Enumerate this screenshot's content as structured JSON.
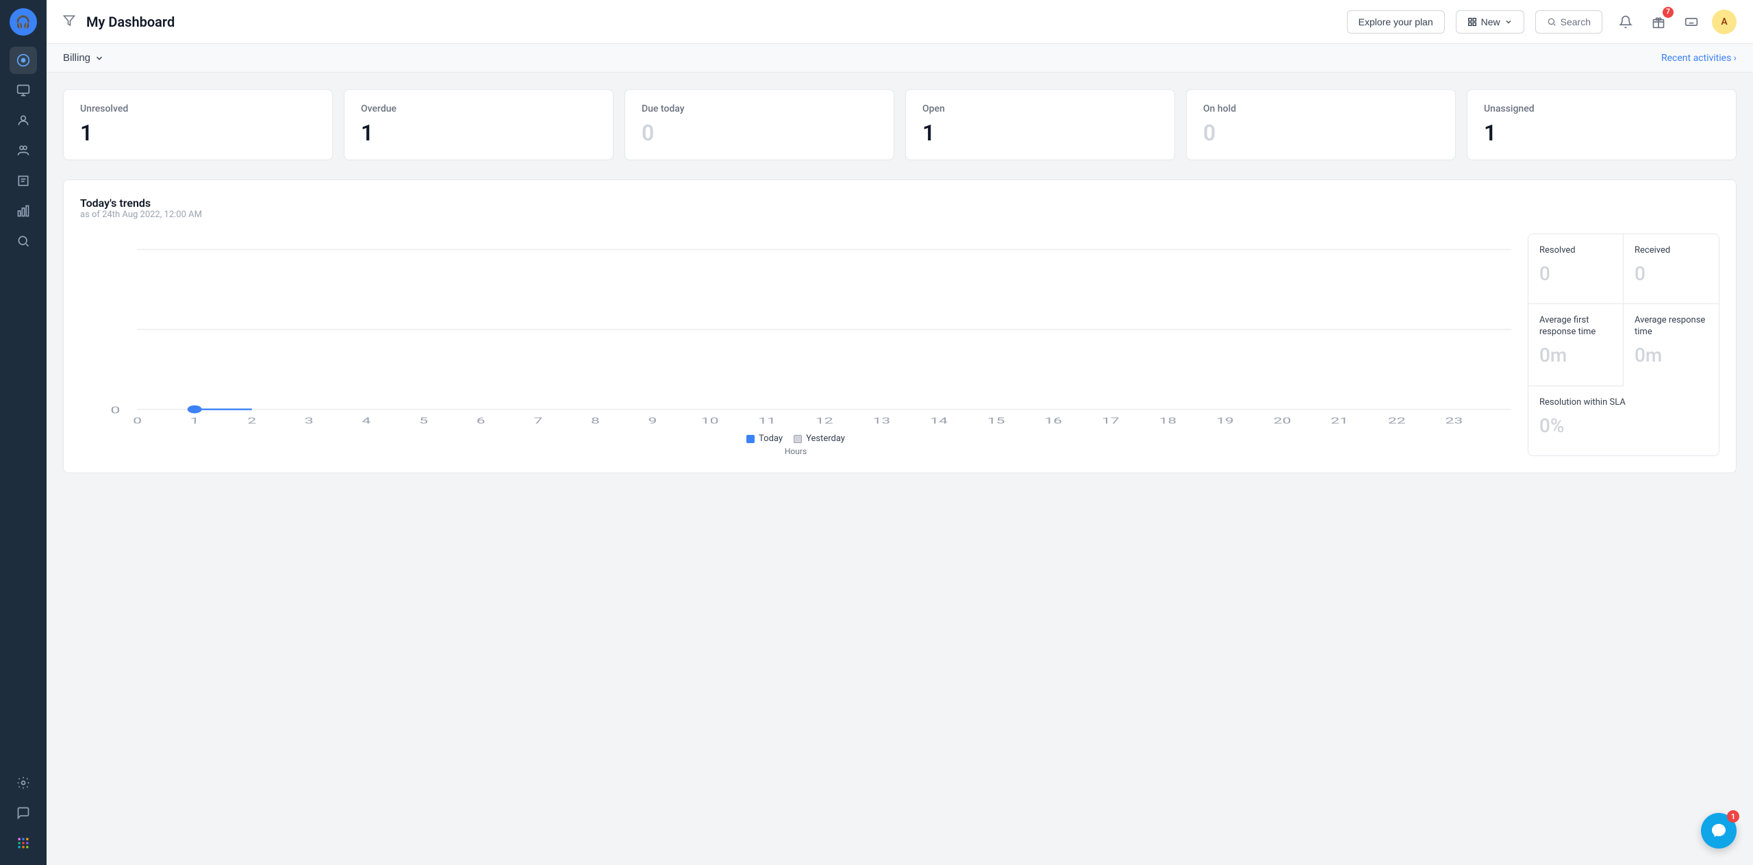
{
  "sidebar": {
    "logo": "🎧",
    "items": [
      {
        "name": "dashboard",
        "icon": "◉",
        "active": true
      },
      {
        "name": "conversations",
        "icon": "💬"
      },
      {
        "name": "contacts",
        "icon": "👤"
      },
      {
        "name": "teams",
        "icon": "👥"
      },
      {
        "name": "knowledge",
        "icon": "📖"
      },
      {
        "name": "reports",
        "icon": "📊"
      },
      {
        "name": "campaigns",
        "icon": "📣"
      },
      {
        "name": "settings",
        "icon": "⚙️"
      }
    ],
    "bottom_items": [
      {
        "name": "notifications",
        "icon": "🔔"
      },
      {
        "name": "apps",
        "icon": "⬛"
      }
    ]
  },
  "topbar": {
    "filter_icon": "filter",
    "title": "My Dashboard",
    "explore_label": "Explore your plan",
    "new_label": "New",
    "search_label": "Search",
    "notification_count": "7",
    "avatar_label": "A"
  },
  "subheader": {
    "billing_label": "Billing",
    "recent_activities_label": "Recent activities ›"
  },
  "stats_cards": [
    {
      "label": "Unresolved",
      "value": "1",
      "is_zero": false
    },
    {
      "label": "Overdue",
      "value": "1",
      "is_zero": false
    },
    {
      "label": "Due today",
      "value": "0",
      "is_zero": true
    },
    {
      "label": "Open",
      "value": "1",
      "is_zero": false
    },
    {
      "label": "On hold",
      "value": "0",
      "is_zero": true
    },
    {
      "label": "Unassigned",
      "value": "1",
      "is_zero": false
    }
  ],
  "trends": {
    "title": "Today's trends",
    "subtitle": "as of 24th Aug 2022, 12:00 AM",
    "x_axis_label": "Hours",
    "x_ticks": [
      "0",
      "1",
      "2",
      "3",
      "4",
      "5",
      "6",
      "7",
      "8",
      "9",
      "10",
      "11",
      "12",
      "13",
      "14",
      "15",
      "16",
      "17",
      "18",
      "19",
      "20",
      "21",
      "22",
      "23"
    ],
    "y_tick": "0",
    "legend": [
      {
        "label": "Today",
        "color": "#3b82f6"
      },
      {
        "label": "Yesterday",
        "color": "#d1d5db"
      }
    ],
    "stats": [
      {
        "label": "Resolved",
        "value": "0"
      },
      {
        "label": "Received",
        "value": "0"
      },
      {
        "label": "Average first response time",
        "value": "0m"
      },
      {
        "label": "Average response time",
        "value": "0m"
      },
      {
        "label": "Resolution within SLA",
        "value": "0%",
        "full_width": true
      }
    ]
  },
  "chat_float": {
    "badge": "1"
  }
}
